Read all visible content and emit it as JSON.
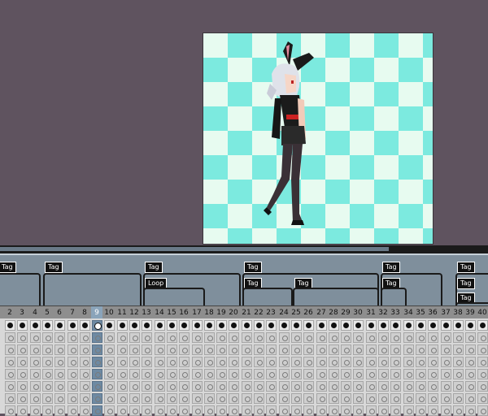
{
  "canvas": {
    "checker_light": "#e7fbf0",
    "checker_dark": "#7ceadf",
    "background": "#5f535f"
  },
  "tags": [
    {
      "label": "Tag"
    },
    {
      "label": "Tag"
    },
    {
      "label": "Tag"
    },
    {
      "label": "Loop"
    },
    {
      "label": "Tag"
    },
    {
      "label": "Tag"
    },
    {
      "label": "Tag"
    },
    {
      "label": "Tag"
    },
    {
      "label": "Tag"
    },
    {
      "label": "Tag"
    },
    {
      "label": "Tag"
    },
    {
      "label": "Tag"
    }
  ],
  "timeline": {
    "frames": [
      "2",
      "3",
      "4",
      "5",
      "6",
      "7",
      "8",
      "9",
      "10",
      "11",
      "12",
      "13",
      "14",
      "15",
      "16",
      "17",
      "18",
      "19",
      "20",
      "21",
      "22",
      "23",
      "24",
      "25",
      "26",
      "27",
      "28",
      "29",
      "30",
      "31",
      "32",
      "33",
      "34",
      "35",
      "36",
      "37",
      "38",
      "39",
      "40"
    ],
    "active_frame": "9",
    "active_color": "#6e8aa3"
  }
}
